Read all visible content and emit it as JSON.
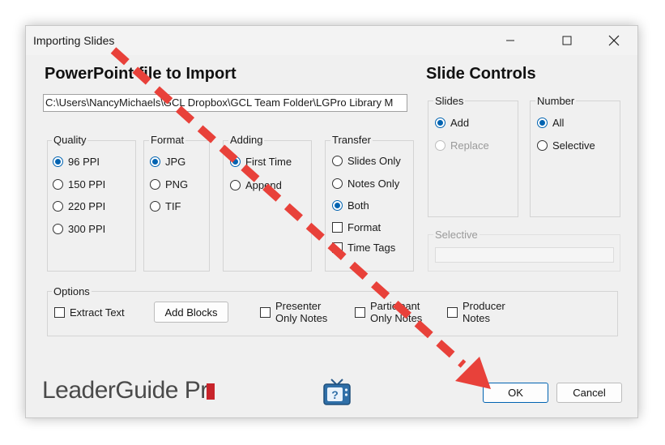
{
  "window": {
    "title": "Importing Slides"
  },
  "headings": {
    "import": "PowerPoint file to Import",
    "controls": "Slide Controls"
  },
  "file_path": "C:\\Users\\NancyMichaels\\GCL Dropbox\\GCL Team Folder\\LGPro Library M",
  "quality": {
    "label": "Quality",
    "options": [
      "96 PPI",
      "150 PPI",
      "220 PPI",
      "300 PPI"
    ],
    "selected": "96 PPI"
  },
  "format": {
    "label": "Format",
    "options": [
      "JPG",
      "PNG",
      "TIF"
    ],
    "selected": "JPG"
  },
  "adding": {
    "label": "Adding",
    "options": [
      "First Time",
      "Append"
    ],
    "selected": "First Time"
  },
  "transfer": {
    "label": "Transfer",
    "radios": [
      "Slides Only",
      "Notes Only",
      "Both"
    ],
    "selected": "Both",
    "checks": [
      "Format",
      "Time Tags"
    ]
  },
  "slides": {
    "label": "Slides",
    "options": [
      "Add",
      "Replace"
    ],
    "selected": "Add"
  },
  "number": {
    "label": "Number",
    "options": [
      "All",
      "Selective"
    ],
    "selected": "All"
  },
  "selective": {
    "label": "Selective"
  },
  "options": {
    "label": "Options",
    "extract_text": "Extract Text",
    "add_blocks": "Add Blocks",
    "presenter_notes": [
      "Presenter",
      "Only Notes"
    ],
    "participant_notes": [
      "Participant",
      "Only Notes"
    ],
    "producer_notes": [
      "Producer",
      "Notes"
    ]
  },
  "buttons": {
    "ok": "OK",
    "cancel": "Cancel"
  },
  "logo": {
    "text": "LeaderGuide Pr"
  },
  "colors": {
    "accent": "#0063b1",
    "arrow": "#e8413a",
    "logo_red": "#c8242b"
  },
  "icons": {
    "minimize": "minimize-icon",
    "maximize": "maximize-icon",
    "close": "close-icon",
    "help": "tv-help-icon"
  }
}
